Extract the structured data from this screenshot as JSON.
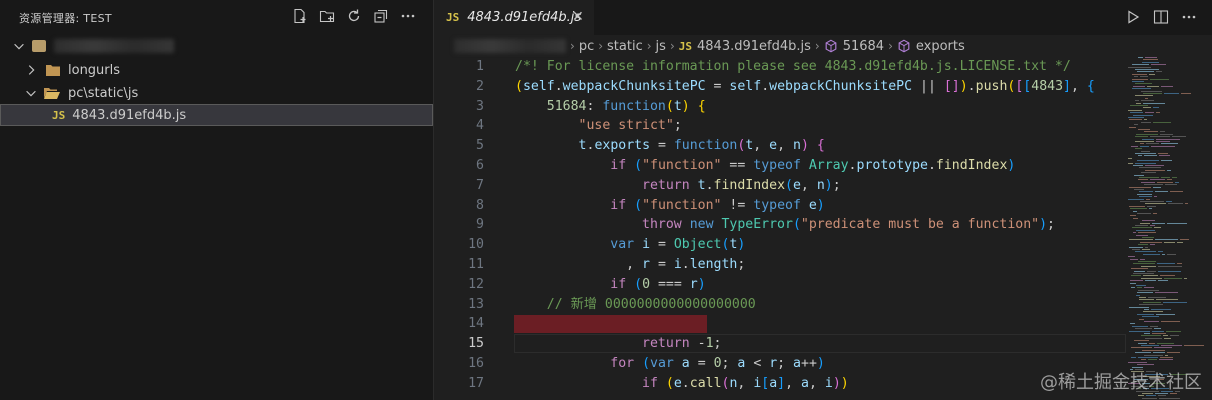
{
  "explorer": {
    "title": "资源管理器: TEST",
    "actions": [
      {
        "name": "new-file-icon"
      },
      {
        "name": "new-folder-icon"
      },
      {
        "name": "refresh-icon"
      },
      {
        "name": "collapse-all-icon"
      },
      {
        "name": "more-icon"
      }
    ],
    "items": [
      {
        "label": "longurls",
        "kind": "folder"
      },
      {
        "label": "pc\\static\\js",
        "kind": "folder-open"
      },
      {
        "label": "4843.d91efd4b.js",
        "kind": "js-file",
        "badge": "JS"
      }
    ]
  },
  "editor": {
    "tab": {
      "badge": "JS",
      "title": "4843.d91efd4b.js",
      "close": "✕"
    },
    "breadcrumb": [
      "pc",
      "static",
      "js",
      "4843.d91efd4b.js",
      "51684",
      "exports"
    ],
    "active_line": 15
  },
  "code_lines": [
    {
      "n": "1",
      "tokens": [
        [
          "cm",
          "/*! For license information please see 4843.d91efd4b.js.LICENSE.txt */"
        ]
      ]
    },
    {
      "n": "2",
      "tokens": [
        [
          "b1",
          "("
        ],
        [
          "var",
          "self"
        ],
        [
          "p",
          "."
        ],
        [
          "var",
          "webpackChunksitePC"
        ],
        [
          "p",
          " = "
        ],
        [
          "var",
          "self"
        ],
        [
          "p",
          "."
        ],
        [
          "var",
          "webpackChunksitePC"
        ],
        [
          "p",
          " || "
        ],
        [
          "b2",
          "[]"
        ],
        [
          "b1",
          ")"
        ],
        [
          "p",
          "."
        ],
        [
          "fn",
          "push"
        ],
        [
          "b1",
          "("
        ],
        [
          "b2",
          "["
        ],
        [
          "b3",
          "["
        ],
        [
          "num",
          "4843"
        ],
        [
          "b3",
          "]"
        ],
        [
          "p",
          ", "
        ],
        [
          "b3",
          "{"
        ]
      ]
    },
    {
      "n": "3",
      "tokens": [
        [
          "p",
          "    "
        ],
        [
          "num",
          "51684"
        ],
        [
          "p",
          ": "
        ],
        [
          "kw",
          "function"
        ],
        [
          "b1",
          "("
        ],
        [
          "var",
          "t"
        ],
        [
          "b1",
          ")"
        ],
        [
          "p",
          " "
        ],
        [
          "b1",
          "{"
        ]
      ]
    },
    {
      "n": "4",
      "tokens": [
        [
          "p",
          "        "
        ],
        [
          "str",
          "\"use strict\""
        ],
        [
          "p",
          ";"
        ]
      ]
    },
    {
      "n": "5",
      "tokens": [
        [
          "p",
          "        "
        ],
        [
          "var",
          "t"
        ],
        [
          "p",
          "."
        ],
        [
          "var",
          "exports"
        ],
        [
          "p",
          " = "
        ],
        [
          "kw",
          "function"
        ],
        [
          "b2",
          "("
        ],
        [
          "var",
          "t"
        ],
        [
          "p",
          ", "
        ],
        [
          "var",
          "e"
        ],
        [
          "p",
          ", "
        ],
        [
          "var",
          "n"
        ],
        [
          "b2",
          ")"
        ],
        [
          "p",
          " "
        ],
        [
          "b2",
          "{"
        ]
      ]
    },
    {
      "n": "6",
      "tokens": [
        [
          "p",
          "            "
        ],
        [
          "ctl",
          "if"
        ],
        [
          "p",
          " "
        ],
        [
          "b3",
          "("
        ],
        [
          "str",
          "\"function\""
        ],
        [
          "p",
          " == "
        ],
        [
          "kw",
          "typeof"
        ],
        [
          "p",
          " "
        ],
        [
          "cls",
          "Array"
        ],
        [
          "p",
          "."
        ],
        [
          "var",
          "prototype"
        ],
        [
          "p",
          "."
        ],
        [
          "fn",
          "findIndex"
        ],
        [
          "b3",
          ")"
        ]
      ]
    },
    {
      "n": "7",
      "tokens": [
        [
          "p",
          "                "
        ],
        [
          "ctl",
          "return"
        ],
        [
          "p",
          " "
        ],
        [
          "var",
          "t"
        ],
        [
          "p",
          "."
        ],
        [
          "fn",
          "findIndex"
        ],
        [
          "b3",
          "("
        ],
        [
          "var",
          "e"
        ],
        [
          "p",
          ", "
        ],
        [
          "var",
          "n"
        ],
        [
          "b3",
          ")"
        ],
        [
          "p",
          ";"
        ]
      ]
    },
    {
      "n": "8",
      "tokens": [
        [
          "p",
          "            "
        ],
        [
          "ctl",
          "if"
        ],
        [
          "p",
          " "
        ],
        [
          "b3",
          "("
        ],
        [
          "str",
          "\"function\""
        ],
        [
          "p",
          " != "
        ],
        [
          "kw",
          "typeof"
        ],
        [
          "p",
          " "
        ],
        [
          "var",
          "e"
        ],
        [
          "b3",
          ")"
        ]
      ]
    },
    {
      "n": "9",
      "tokens": [
        [
          "p",
          "                "
        ],
        [
          "ctl",
          "throw"
        ],
        [
          "p",
          " "
        ],
        [
          "kw",
          "new"
        ],
        [
          "p",
          " "
        ],
        [
          "cls",
          "TypeError"
        ],
        [
          "b3",
          "("
        ],
        [
          "str",
          "\"predicate must be a function\""
        ],
        [
          "b3",
          ")"
        ],
        [
          "p",
          ";"
        ]
      ]
    },
    {
      "n": "10",
      "tokens": [
        [
          "p",
          "            "
        ],
        [
          "kw",
          "var"
        ],
        [
          "p",
          " "
        ],
        [
          "var",
          "i"
        ],
        [
          "p",
          " = "
        ],
        [
          "cls",
          "Object"
        ],
        [
          "b3",
          "("
        ],
        [
          "var",
          "t"
        ],
        [
          "b3",
          ")"
        ]
      ]
    },
    {
      "n": "11",
      "tokens": [
        [
          "p",
          "              , "
        ],
        [
          "var",
          "r"
        ],
        [
          "p",
          " = "
        ],
        [
          "var",
          "i"
        ],
        [
          "p",
          "."
        ],
        [
          "var",
          "length"
        ],
        [
          "p",
          ";"
        ]
      ]
    },
    {
      "n": "12",
      "tokens": [
        [
          "p",
          "            "
        ],
        [
          "ctl",
          "if"
        ],
        [
          "p",
          " "
        ],
        [
          "b3",
          "("
        ],
        [
          "num",
          "0"
        ],
        [
          "p",
          " === "
        ],
        [
          "var",
          "r"
        ],
        [
          "b3",
          ")"
        ]
      ]
    },
    {
      "n": "13",
      "tokens": [
        [
          "p",
          "    "
        ],
        [
          "cm",
          "// 新增 0000000000000000000"
        ]
      ]
    },
    {
      "n": "14",
      "tokens": []
    },
    {
      "n": "15",
      "tokens": [
        [
          "p",
          "                "
        ],
        [
          "ctl",
          "return"
        ],
        [
          "p",
          " -"
        ],
        [
          "num",
          "1"
        ],
        [
          "p",
          ";"
        ]
      ]
    },
    {
      "n": "16",
      "tokens": [
        [
          "p",
          "            "
        ],
        [
          "ctl",
          "for"
        ],
        [
          "p",
          " "
        ],
        [
          "b3",
          "("
        ],
        [
          "kw",
          "var"
        ],
        [
          "p",
          " "
        ],
        [
          "var",
          "a"
        ],
        [
          "p",
          " = "
        ],
        [
          "num",
          "0"
        ],
        [
          "p",
          "; "
        ],
        [
          "var",
          "a"
        ],
        [
          "p",
          " < "
        ],
        [
          "var",
          "r"
        ],
        [
          "p",
          "; "
        ],
        [
          "var",
          "a"
        ],
        [
          "p",
          "++"
        ],
        [
          "b3",
          ")"
        ]
      ]
    },
    {
      "n": "17",
      "tokens": [
        [
          "p",
          "                "
        ],
        [
          "ctl",
          "if"
        ],
        [
          "p",
          " "
        ],
        [
          "b1",
          "("
        ],
        [
          "var",
          "e"
        ],
        [
          "p",
          "."
        ],
        [
          "fn",
          "call"
        ],
        [
          "b2",
          "("
        ],
        [
          "var",
          "n"
        ],
        [
          "p",
          ", "
        ],
        [
          "var",
          "i"
        ],
        [
          "b3",
          "["
        ],
        [
          "var",
          "a"
        ],
        [
          "b3",
          "]"
        ],
        [
          "p",
          ", "
        ],
        [
          "var",
          "a"
        ],
        [
          "p",
          ", "
        ],
        [
          "var",
          "i"
        ],
        [
          "b2",
          ")"
        ],
        [
          "b1",
          ")"
        ]
      ]
    }
  ],
  "watermark": "@稀土掘金技术社区",
  "colors": {
    "comment": "#6a9955",
    "keyword": "#569cd6",
    "control": "#c586c0",
    "string": "#ce9178",
    "function": "#dcdcaa",
    "variable": "#9cdcfe",
    "number": "#b5cea8",
    "class": "#4ec9b0",
    "js_badge": "#d6c24b",
    "error_mark": "#6b1e24"
  }
}
